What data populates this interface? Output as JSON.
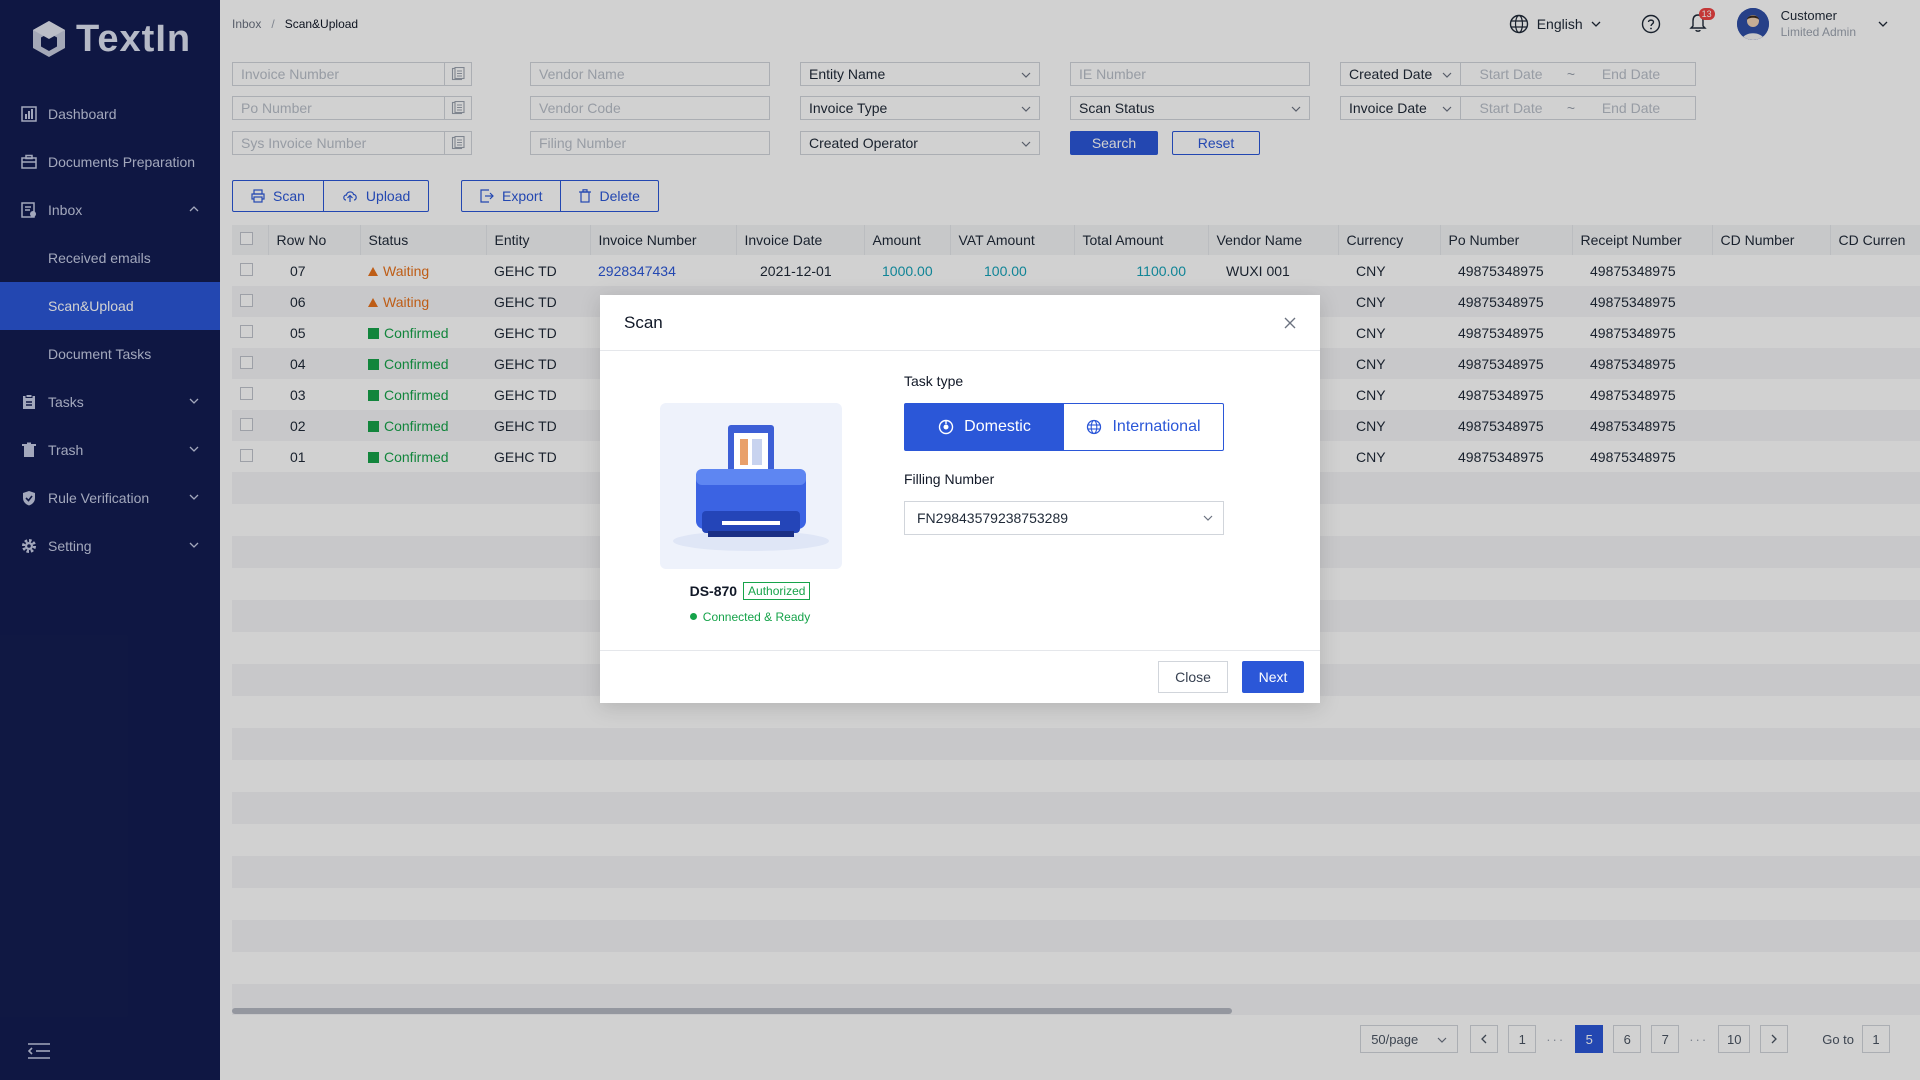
{
  "app": {
    "name": "TextIn"
  },
  "sidebar": {
    "items": [
      {
        "label": "Dashboard",
        "icon": "bar-chart-icon"
      },
      {
        "label": "Documents Preparation",
        "icon": "briefcase-icon"
      },
      {
        "label": "Inbox",
        "icon": "inbox-icon",
        "expanded": true
      },
      {
        "label": "Tasks",
        "icon": "clipboard-icon"
      },
      {
        "label": "Trash",
        "icon": "trash-icon"
      },
      {
        "label": "Rule Verification",
        "icon": "shield-check-icon"
      },
      {
        "label": "Setting",
        "icon": "gear-icon"
      }
    ],
    "inbox_sub": [
      {
        "label": "Received emails"
      },
      {
        "label": "Scan&Upload",
        "active": true
      },
      {
        "label": "Document Tasks"
      }
    ]
  },
  "breadcrumb": {
    "root": "Inbox",
    "separator": "/",
    "current": "Scan&Upload"
  },
  "header": {
    "language": "English",
    "notifications": "13",
    "user_name": "Customer",
    "user_role": "Limited Admin"
  },
  "filters": {
    "invoice_number": "Invoice Number",
    "vendor_name": "Vendor Name",
    "entity_name": "Entity Name",
    "ie_number": "IE Number",
    "created_date": "Created Date",
    "po_number": "Po Number",
    "vendor_code": "Vendor Code",
    "invoice_type": "Invoice Type",
    "scan_status": "Scan Status",
    "invoice_date": "Invoice Date",
    "sys_invoice_number": "Sys Invoice Number",
    "filing_number": "Filing Number",
    "created_operator": "Created Operator",
    "start_date": "Start Date",
    "end_date": "End Date",
    "tilde": "~",
    "search": "Search",
    "reset": "Reset"
  },
  "actions": {
    "scan": "Scan",
    "upload": "Upload",
    "export": "Export",
    "delete": "Delete"
  },
  "table": {
    "columns": [
      "Row No",
      "Status",
      "Entity",
      "Invoice Number",
      "Invoice Date",
      "Amount",
      "VAT Amount",
      "Total Amount",
      "Vendor Name",
      "Currency",
      "Po Number",
      "Receipt Number",
      "CD Number",
      "CD Curren"
    ],
    "rows": [
      {
        "row": "07",
        "status": "Waiting",
        "entity": "GEHC TD",
        "invoice": "2928347434",
        "date": "2021-12-01",
        "amount": "1000.00",
        "vat": "100.00",
        "total": "1100.00",
        "vendor": "WUXI 001",
        "currency": "CNY",
        "po": "49875348975",
        "receipt": "49875348975"
      },
      {
        "row": "06",
        "status": "Waiting",
        "entity": "GEHC TD",
        "currency": "CNY",
        "po": "49875348975",
        "receipt": "49875348975"
      },
      {
        "row": "05",
        "status": "Confirmed",
        "entity": "GEHC TD",
        "currency": "CNY",
        "po": "49875348975",
        "receipt": "49875348975"
      },
      {
        "row": "04",
        "status": "Confirmed",
        "entity": "GEHC TD",
        "currency": "CNY",
        "po": "49875348975",
        "receipt": "49875348975"
      },
      {
        "row": "03",
        "status": "Confirmed",
        "entity": "GEHC TD",
        "currency": "CNY",
        "po": "49875348975",
        "receipt": "49875348975"
      },
      {
        "row": "02",
        "status": "Confirmed",
        "entity": "GEHC TD",
        "currency": "CNY",
        "po": "49875348975",
        "receipt": "49875348975"
      },
      {
        "row": "01",
        "status": "Confirmed",
        "entity": "GEHC TD",
        "currency": "CNY",
        "po": "49875348975",
        "receipt": "49875348975"
      }
    ]
  },
  "pagination": {
    "page_size": "50/page",
    "pages": [
      "1",
      "5",
      "6",
      "7",
      "10"
    ],
    "current": "5",
    "ellipsis": "···",
    "goto_label": "Go to",
    "goto_value": "1"
  },
  "modal": {
    "title": "Scan",
    "device": {
      "name": "DS-870",
      "badge": "Authorized",
      "status": "Connected & Ready"
    },
    "task_type_label": "Task type",
    "task_types": [
      "Domestic",
      "International"
    ],
    "task_type_selected": "Domestic",
    "filling_label": "Filling Number",
    "filling_value": "FN29843579238753289",
    "close": "Close",
    "next": "Next"
  },
  "colors": {
    "primary": "#2b57d8",
    "sidebar": "#131d52",
    "success": "#16a34a",
    "warning": "#e8721c",
    "amount": "#14a2b8"
  }
}
